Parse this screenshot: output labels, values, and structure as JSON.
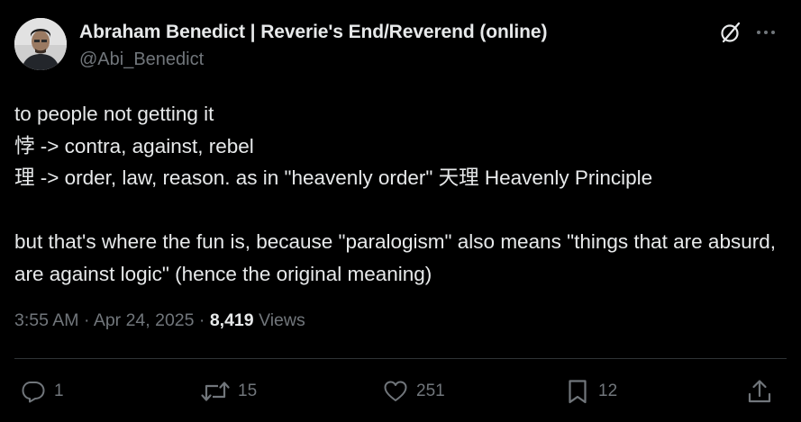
{
  "author": {
    "display_name": "Abraham Benedict | Reverie's End/Reverend (online)",
    "handle": "@Abi_Benedict",
    "avatar_icon": "user-photo"
  },
  "tweet": {
    "text": "to people not getting it\n悖 -> contra, against, rebel\n理 -> order, law, reason. as in \"heavenly order\" 天理 Heavenly Principle\n\nbut that's where the fun is, because \"paralogism\" also means \"things that are absurd, are against logic\" (hence the original meaning)"
  },
  "meta": {
    "time": "3:55 AM",
    "date": "Apr 24, 2025",
    "separator": "·",
    "views_count": "8,419",
    "views_label": "Views"
  },
  "actions": {
    "replies": "1",
    "reposts": "15",
    "likes": "251",
    "bookmarks": "12"
  },
  "icons": {
    "grok": "grok-icon",
    "more": "more-icon",
    "reply": "reply-icon",
    "repost": "repost-icon",
    "like": "heart-icon",
    "bookmark": "bookmark-icon",
    "share": "share-icon"
  },
  "colors": {
    "background": "#000000",
    "text": "#e7e9ea",
    "secondary": "#71767b",
    "divider": "#2f3336"
  }
}
